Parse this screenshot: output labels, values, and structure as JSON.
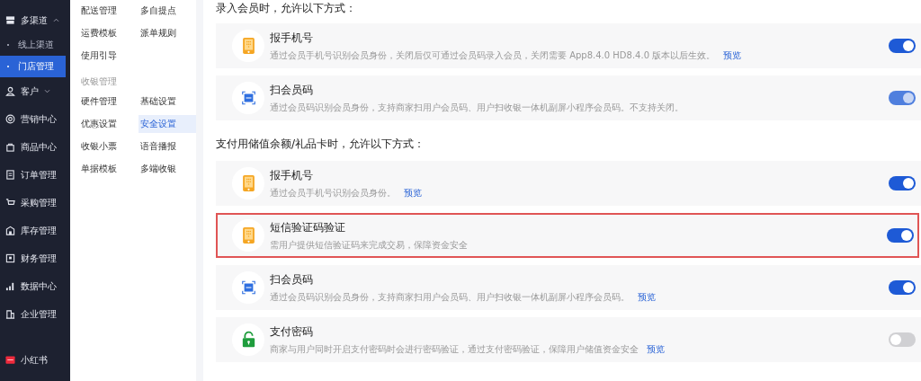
{
  "sidebar": {
    "items": [
      {
        "label": "多渠道",
        "expanded": true,
        "children": [
          {
            "label": "线上渠道",
            "selected": false
          },
          {
            "label": "门店管理",
            "selected": true
          }
        ]
      },
      {
        "label": "客户",
        "expanded": false
      },
      {
        "label": "营销中心"
      },
      {
        "label": "商品中心"
      },
      {
        "label": "订单管理"
      },
      {
        "label": "采购管理"
      },
      {
        "label": "库存管理"
      },
      {
        "label": "财务管理"
      },
      {
        "label": "数据中心"
      },
      {
        "label": "企业管理"
      }
    ],
    "footer": {
      "label": "小红书"
    }
  },
  "submenu": {
    "groups": [
      {
        "items": [
          {
            "label": "配送管理",
            "selected": false
          },
          {
            "label": "多自提点",
            "selected": false
          },
          {
            "label": "运费模板",
            "selected": false
          },
          {
            "label": "派单规则",
            "selected": false
          },
          {
            "label": "使用引导",
            "selected": false
          }
        ]
      },
      {
        "title": "收银管理",
        "items": [
          {
            "label": "硬件管理",
            "selected": false
          },
          {
            "label": "基础设置",
            "selected": false
          },
          {
            "label": "优惠设置",
            "selected": false
          },
          {
            "label": "安全设置",
            "selected": true
          },
          {
            "label": "收银小票",
            "selected": false
          },
          {
            "label": "语音播报",
            "selected": false
          },
          {
            "label": "单据模板",
            "selected": false
          },
          {
            "label": "多端收银",
            "selected": false
          }
        ]
      }
    ]
  },
  "sections": [
    {
      "title": "录入会员时，允许以下方式：",
      "options": [
        {
          "kind": "phone",
          "title": "报手机号",
          "description": "通过会员手机号识别会员身份，关闭后仅可通过会员码录入会员，关闭需要 App8.4.0 HD8.4.0 版本以后生效。",
          "link": "预览",
          "on": true,
          "disabled": false,
          "highlighted": false
        },
        {
          "kind": "scan",
          "title": "扫会员码",
          "description": "通过会员码识别会员身份，支持商家扫用户会员码、用户扫收银一体机副屏小程序会员码。不支持关闭。",
          "on": true,
          "disabled": true,
          "highlighted": false
        }
      ]
    },
    {
      "title": "支付用储值余额/礼品卡时，允许以下方式：",
      "options": [
        {
          "kind": "phone",
          "title": "报手机号",
          "description": "通过会员手机号识别会员身份。",
          "link": "预览",
          "on": true,
          "disabled": false,
          "highlighted": false
        },
        {
          "kind": "phone",
          "title": "短信验证码验证",
          "description": "需用户提供短信验证码来完成交易，保障资金安全",
          "on": true,
          "disabled": false,
          "highlighted": true
        },
        {
          "kind": "scan",
          "title": "扫会员码",
          "description": "通过会员码识别会员身份，支持商家扫用户会员码、用户扫收银一体机副屏小程序会员码。",
          "link": "预览",
          "on": true,
          "disabled": false,
          "highlighted": false
        },
        {
          "kind": "lock",
          "title": "支付密码",
          "description": "商家与用户同时开启支付密码时会进行密码验证，通过支付密码验证，保障用户储值资金安全",
          "link": "预览",
          "on": false,
          "disabled": false,
          "highlighted": false
        }
      ]
    }
  ]
}
